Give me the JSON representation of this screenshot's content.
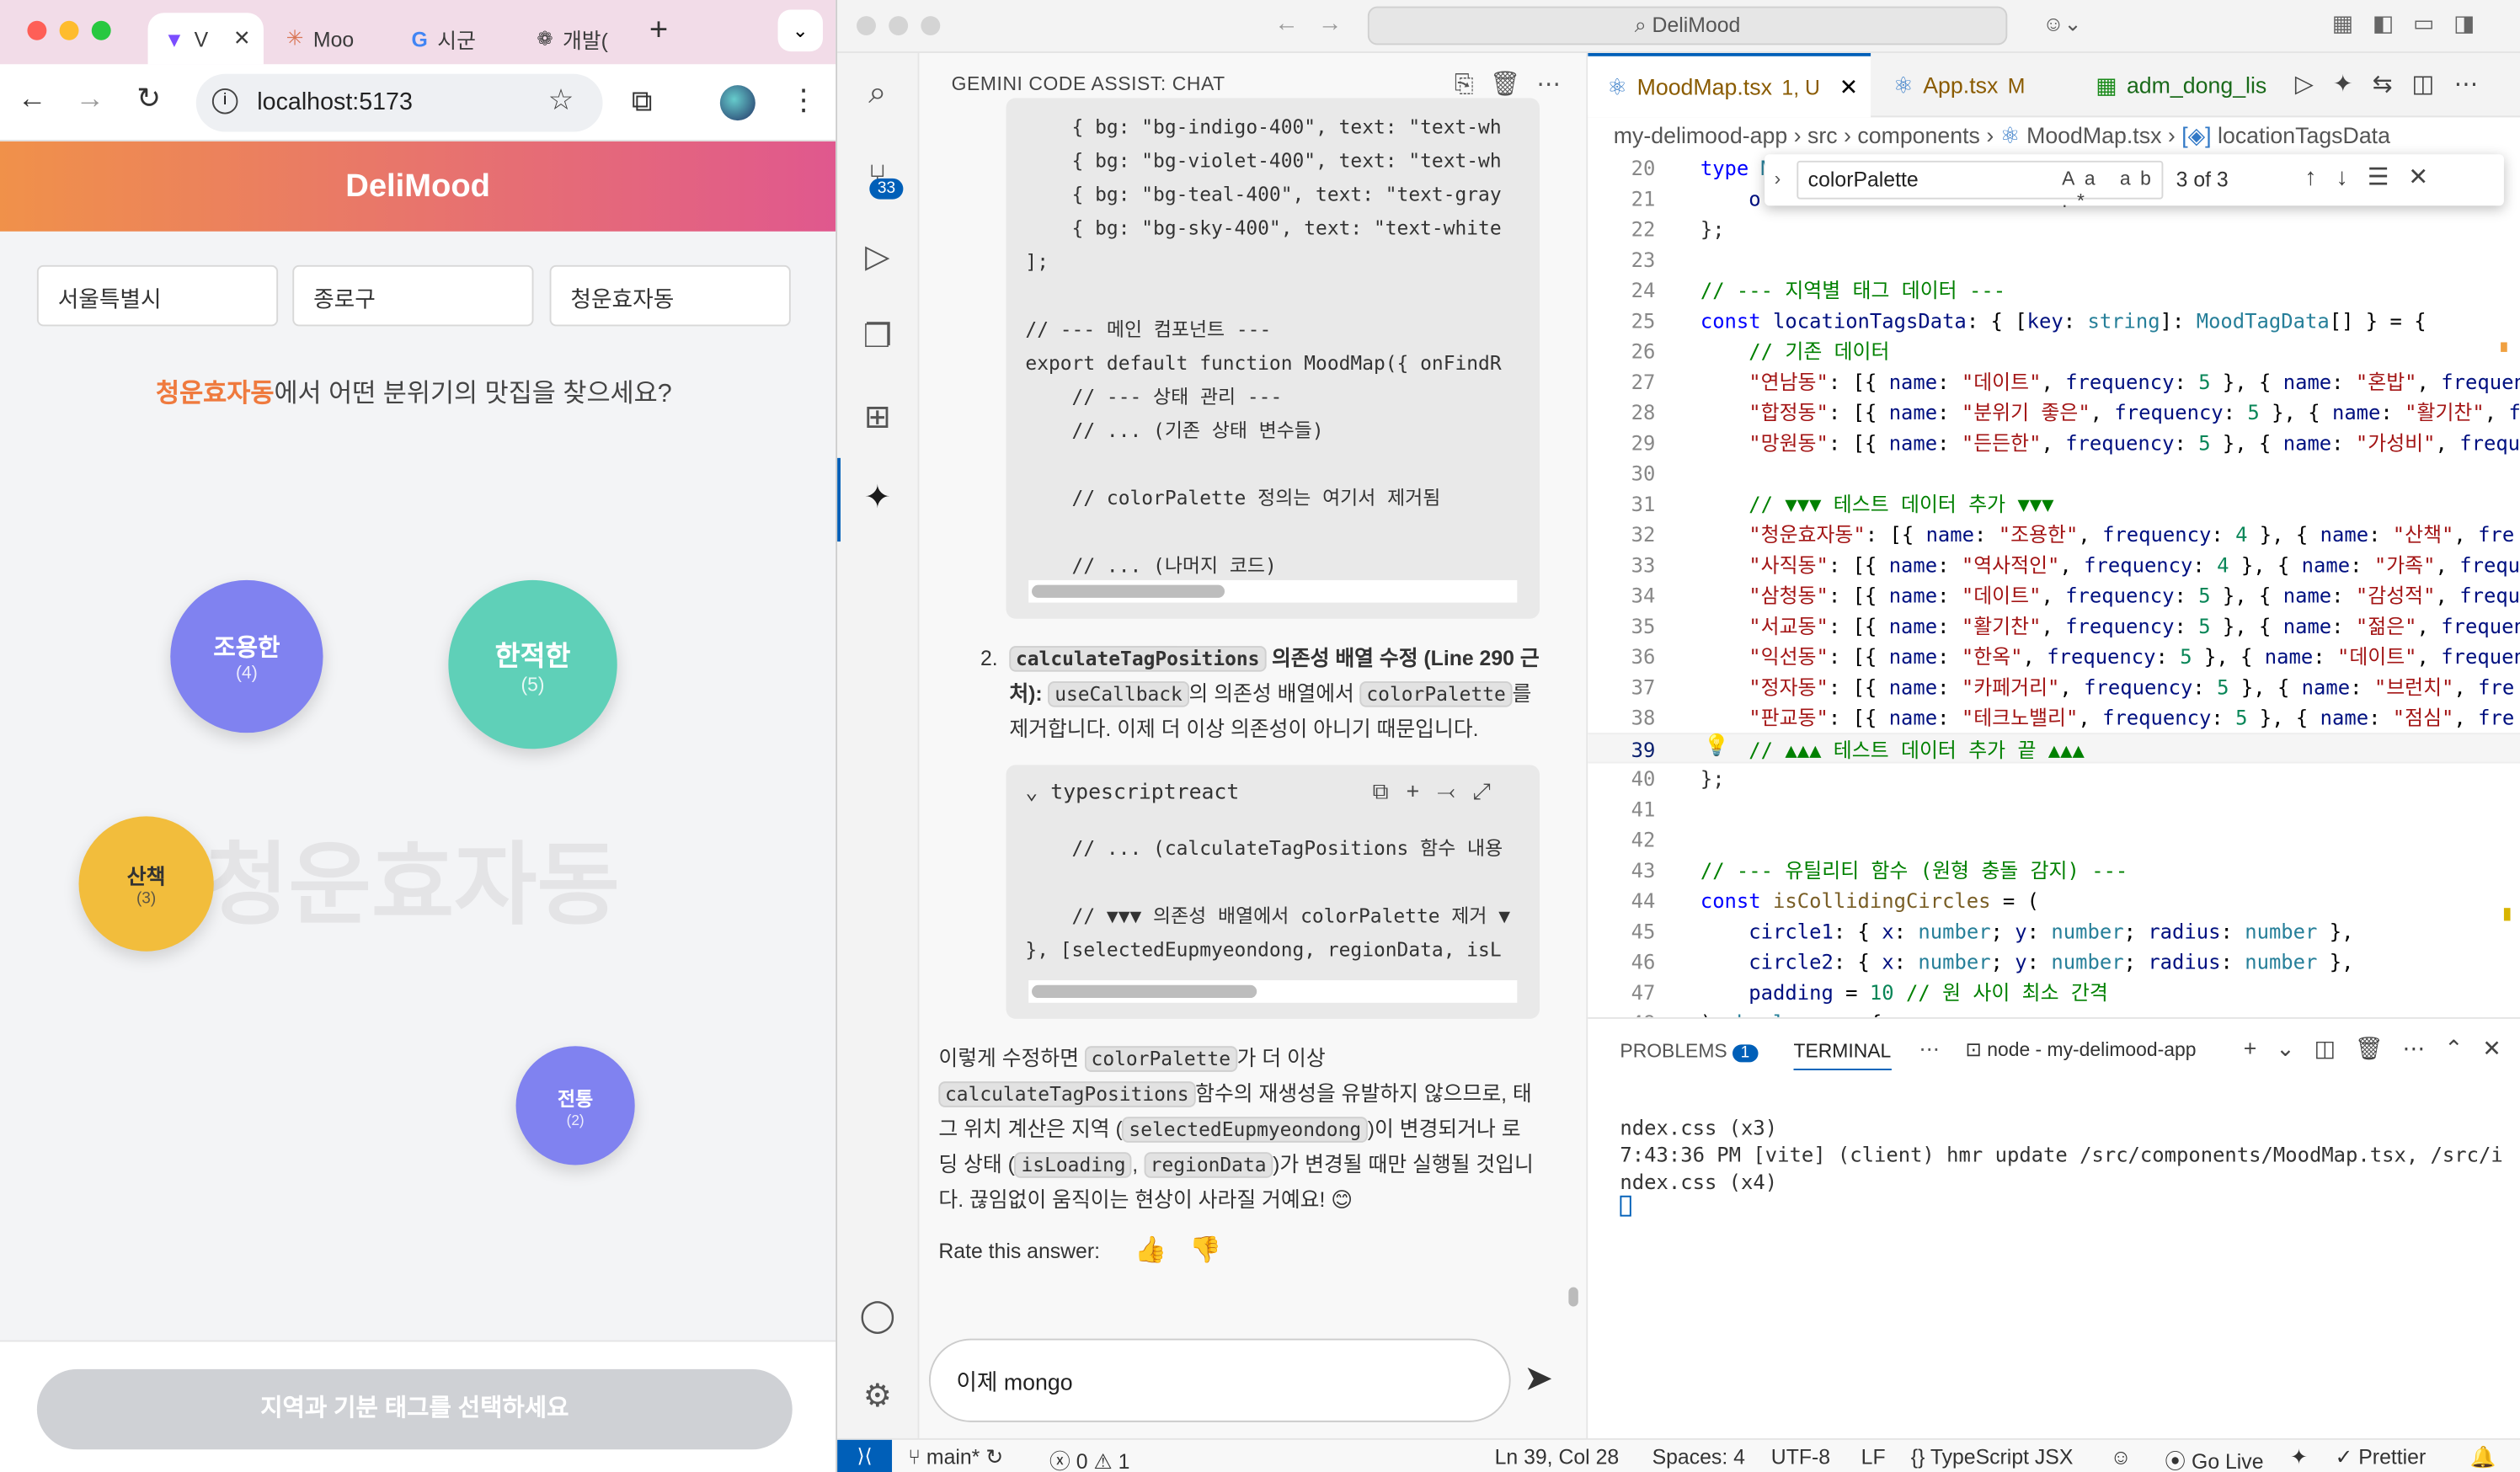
{
  "chrome": {
    "tabs": [
      {
        "label": "V"
      },
      {
        "label": "Moo"
      },
      {
        "label": "시군"
      },
      {
        "label": "개발("
      }
    ],
    "url": "localhost:5173"
  },
  "app": {
    "title": "DeliMood",
    "selects": [
      "서울특별시",
      "종로구",
      "청운효자동"
    ],
    "question_highlight": "청운효자동",
    "question_rest": "에서 어떤 분위기의 맛집을 찾으세요?",
    "watermark": "청운효자동",
    "bubbles": [
      {
        "name": "조용한",
        "count": "(4)",
        "color": "#8082f0"
      },
      {
        "name": "한적한",
        "count": "(5)",
        "color": "#5fd0b8"
      },
      {
        "name": "산책",
        "count": "(3)",
        "color": "#f2bd3c"
      },
      {
        "name": "전통",
        "count": "(2)",
        "color": "#8082f0"
      }
    ],
    "submit_label": "지역과 기분 태그를 선택하세요"
  },
  "vscode": {
    "search": "DeliMood",
    "source_control_badge": "33",
    "chat": {
      "title": "GEMINI CODE ASSIST: CHAT",
      "code1": [
        "    { bg: \"bg-indigo-400\", text: \"text-wh",
        "    { bg: \"bg-violet-400\", text: \"text-wh",
        "    { bg: \"bg-teal-400\", text: \"text-gray",
        "    { bg: \"bg-sky-400\", text: \"text-white",
        "];",
        "",
        "// --- 메인 컴포넌트 ---",
        "export default function MoodMap({ onFindR",
        "    // --- 상태 관리 ---",
        "    // ... (기존 상태 변수들)",
        "",
        "    // colorPalette 정의는 여기서 제거됨",
        "",
        "    // ... (나머지 코드)"
      ],
      "item2_num": "2.",
      "item2_code1": "calculateTagPositions",
      "item2_t1": " 의존성 배열 수정 (Line 290 근처): ",
      "item2_code2": "useCallback",
      "item2_t2": "의 의존성 배열에서 ",
      "item2_code3": "colorPalette",
      "item2_t3": "를 제거합니다. 이제 더 이상 의존성이 아니기 때문입니다.",
      "code2_lang": "typescriptreact",
      "code2": [
        "    // ... (calculateTagPositions 함수 내용",
        "",
        "    // ▼▼▼ 의존성 배열에서 colorPalette 제거 ▼",
        "}, [selectedEupmyeondong, regionData, isL"
      ],
      "para_a": "이렇게 수정하면 ",
      "para_code1": "colorPalette",
      "para_b": "가 더 이상 ",
      "para_code2": "calculateTagPositions",
      "para_c": "함수의 재생성을 유발하지 않으므로, 태그 위치 계산은 지역 (",
      "para_code3": "selectedEupmyeondong",
      "para_d": ")이 변경되거나 로딩 상태 (",
      "para_code4": "isLoading",
      "para_e": ", ",
      "para_code5": "regionData",
      "para_f": ")가 변경될 때만 실행될 것입니다. 끊임없이 움직이는 현상이 사라질 거예요! 😊",
      "rate": "Rate this answer:",
      "input": "이제 mongo"
    },
    "tabs": [
      {
        "label": "MoodMap.tsx",
        "suffix": "1, U"
      },
      {
        "label": "App.tsx",
        "suffix": "M"
      },
      {
        "label": "adm_dong_lis",
        "suffix": ""
      }
    ],
    "breadcrumb": [
      "my-delimood-app",
      "src",
      "components",
      "MoodMap.tsx",
      "locationTagsData"
    ],
    "find": {
      "query": "colorPalette",
      "count": "3 of 3"
    },
    "panel": {
      "problems": "PROBLEMS",
      "problems_count": "1",
      "terminal": "TERMINAL",
      "node": "node - my-delimood-app"
    },
    "terminal_lines": [
      "ndex.css (x3)",
      "7:43:36 PM [vite] (client) hmr update /src/components/MoodMap.tsx, /src/i",
      "ndex.css (x4)"
    ],
    "status": {
      "branch": "main*",
      "errors": "0",
      "warnings": "1",
      "pos": "Ln 39, Col 28",
      "spaces": "Spaces: 4",
      "enc": "UTF-8",
      "eol": "LF",
      "lang": "TypeScript JSX",
      "golive": "Go Live",
      "prettier": "Prettier"
    }
  }
}
